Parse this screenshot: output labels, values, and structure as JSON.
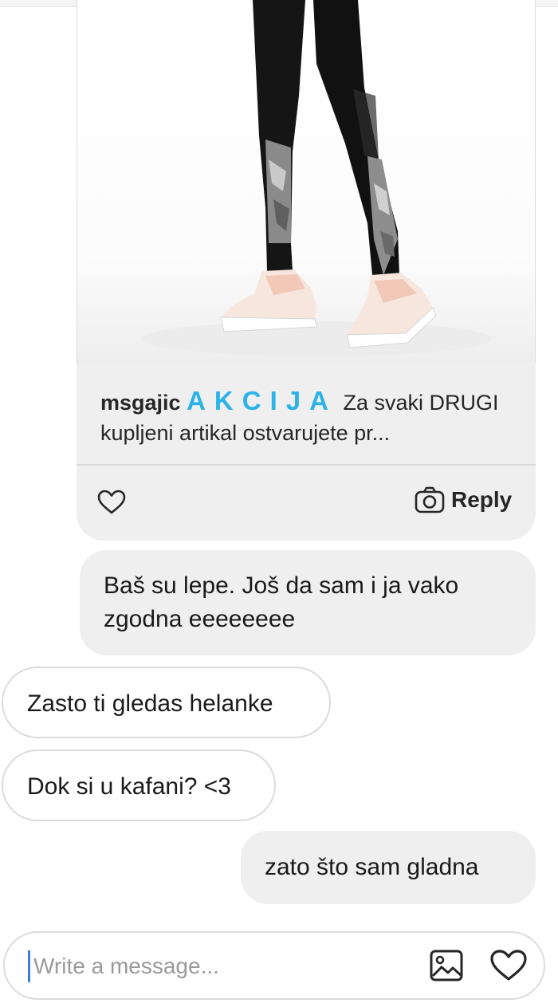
{
  "post": {
    "username": "msgajic",
    "promo_word": "AKCIJA",
    "caption_text": "Za svaki DRUGI kupljeni artikal ostvarujete pr...",
    "reply_label": "Reply",
    "image_subject": "woman-in-black-camo-leggings-and-pink-sneakers"
  },
  "messages": [
    {
      "direction": "outgoing",
      "text": "Baš su lepe. Još da sam i ja vako zgodna eeeeeeee"
    },
    {
      "direction": "incoming",
      "text": "Zasto ti gledas helanke"
    },
    {
      "direction": "incoming",
      "text": "Dok si u kafani? <3"
    },
    {
      "direction": "outgoing",
      "text": "zato što sam gladna"
    }
  ],
  "composer": {
    "placeholder": "Write a message...",
    "value": ""
  },
  "icons": {
    "like": "heart-outline-icon",
    "reply": "camera-icon",
    "gallery": "image-icon",
    "send_heart": "heart-outline-icon"
  },
  "colors": {
    "promo_accent": "#2bb3e8",
    "outgoing_bubble": "#efefef",
    "incoming_border": "#dcdcdc",
    "caret": "#3b7ddd"
  }
}
